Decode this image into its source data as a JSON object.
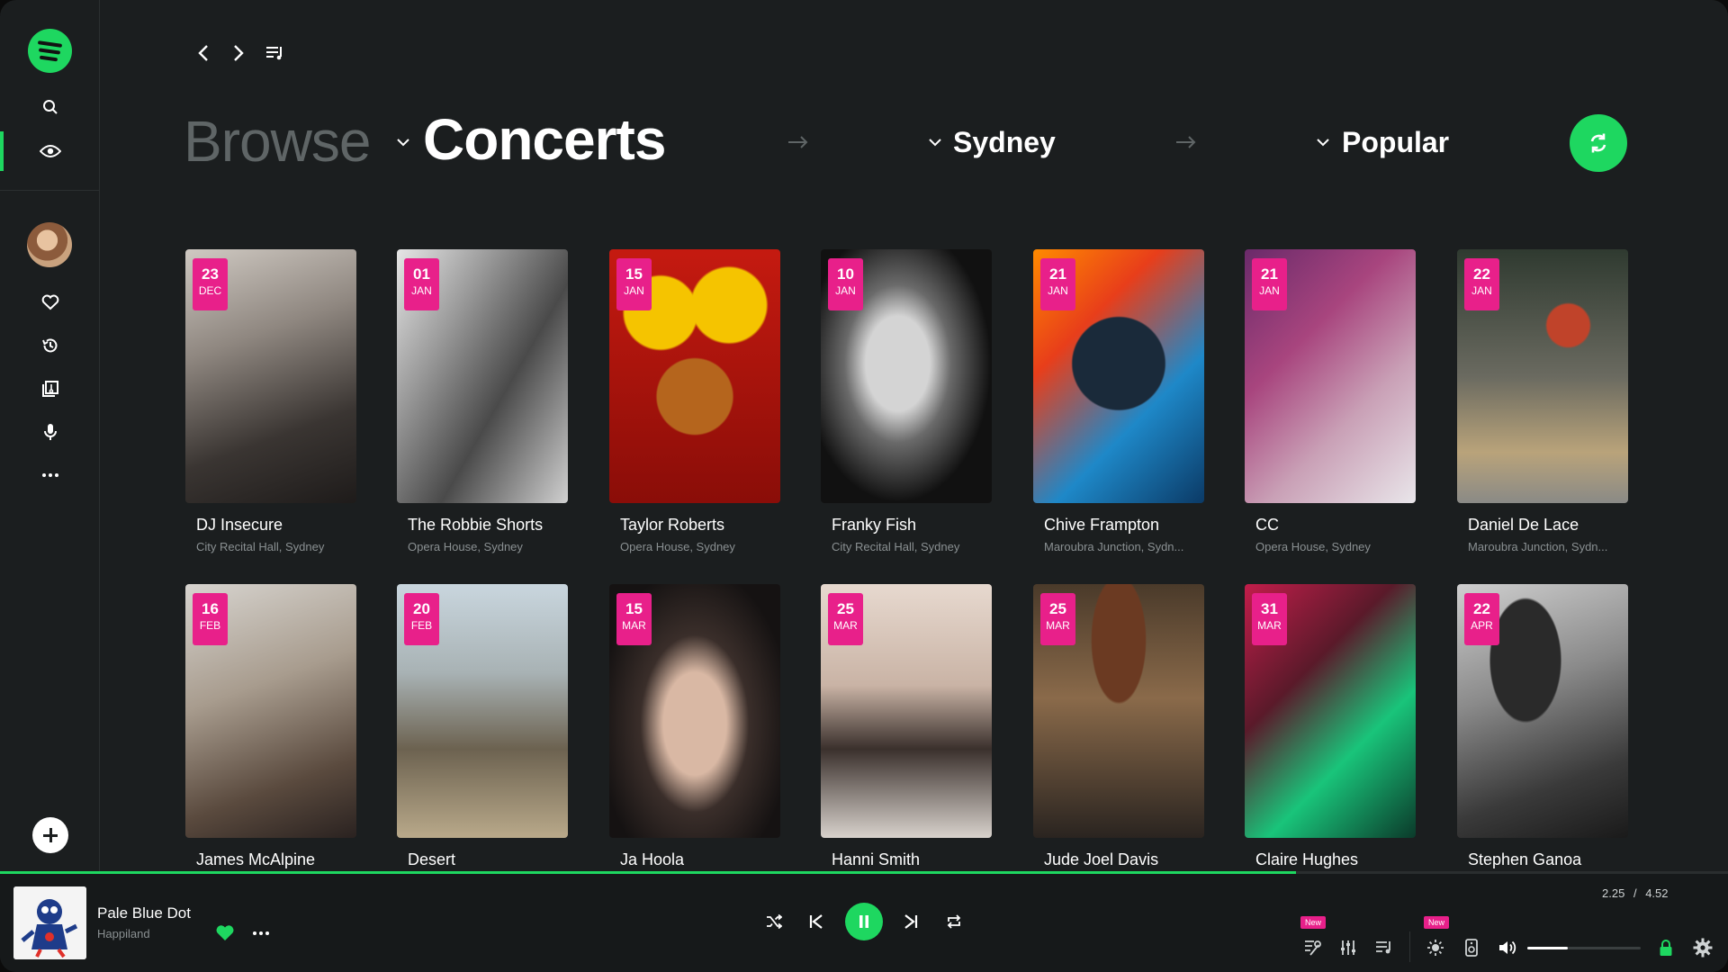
{
  "header": {
    "browse": "Browse",
    "category": "Concerts",
    "location": "Sydney",
    "sort": "Popular"
  },
  "cards": [
    {
      "day": "23",
      "month": "DEC",
      "name": "DJ Insecure",
      "venue": "City Recital Hall, Sydney"
    },
    {
      "day": "01",
      "month": "JAN",
      "name": "The Robbie Shorts",
      "venue": "Opera House, Sydney"
    },
    {
      "day": "15",
      "month": "JAN",
      "name": "Taylor Roberts",
      "venue": "Opera House, Sydney"
    },
    {
      "day": "10",
      "month": "JAN",
      "name": "Franky Fish",
      "venue": "City Recital Hall, Sydney"
    },
    {
      "day": "21",
      "month": "JAN",
      "name": "Chive Frampton",
      "venue": "Maroubra Junction, Sydn..."
    },
    {
      "day": "21",
      "month": "JAN",
      "name": "CC",
      "venue": "Opera House, Sydney"
    },
    {
      "day": "22",
      "month": "JAN",
      "name": "Daniel De Lace",
      "venue": "Maroubra Junction, Sydn..."
    },
    {
      "day": "16",
      "month": "FEB",
      "name": "James McAlpine",
      "venue": ""
    },
    {
      "day": "20",
      "month": "FEB",
      "name": "Desert",
      "venue": ""
    },
    {
      "day": "15",
      "month": "MAR",
      "name": "Ja Hoola",
      "venue": ""
    },
    {
      "day": "25",
      "month": "MAR",
      "name": "Hanni Smith",
      "venue": ""
    },
    {
      "day": "25",
      "month": "MAR",
      "name": "Jude Joel Davis",
      "venue": ""
    },
    {
      "day": "31",
      "month": "MAR",
      "name": "Claire Hughes",
      "venue": ""
    },
    {
      "day": "22",
      "month": "APR",
      "name": "Stephen Ganoa",
      "venue": ""
    }
  ],
  "player": {
    "title": "Pale Blue Dot",
    "artist": "Happiland",
    "elapsed": "2.25",
    "separator": "/",
    "duration": "4.52",
    "progress": 0.75,
    "volume": 0.36,
    "badge_1": "New",
    "badge_2": "New"
  },
  "colors": {
    "accent": "#1ed760",
    "date_badge": "#e8208a",
    "background": "#1b1e1f"
  }
}
